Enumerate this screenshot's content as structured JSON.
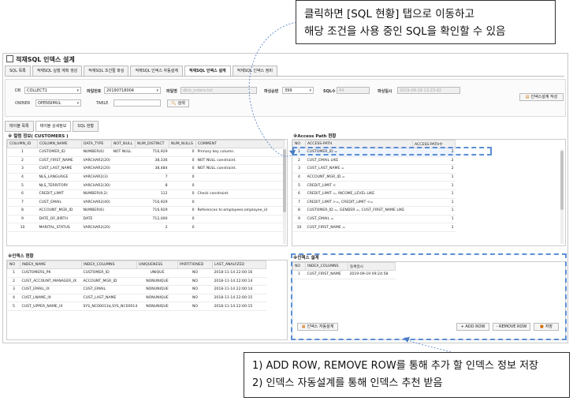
{
  "callouts": {
    "top": [
      "클릭하면 [SQL 현황] 탭으로 이동하고",
      "해당 조건을 사용 중인 SQL을 확인할 수 있음"
    ],
    "bottom": [
      "1) ADD ROW, REMOVE ROW를 통해  추가 할 인덱스 정보 저장",
      "2) 인덱스 자동설계를 통해 인덱스 추천 받음"
    ]
  },
  "window_title": "적재SQL 인덱스 설계",
  "tabs": [
    "SQL 목록",
    "적재SQL 실행 계획 생성",
    "적재SQL 조건절 파싱",
    "적재SQL 인덱스 자동설계",
    "적재SQL 인덱스 설계",
    "적재SQL 인덱스 정비"
  ],
  "active_tab_index": 4,
  "filter": {
    "db_label": "DB",
    "db_value": "COLLECT1",
    "file_no_label": "파일번호",
    "file_no_value": "20190718004",
    "file_name_label": "파일명",
    "file_name_value": "dbio_orders.txt",
    "parse_order_label": "파싱순번",
    "parse_order_value": "399",
    "sql_count_label": "SQL수",
    "sql_count_value": "84",
    "parse_date_label": "파싱일시",
    "parse_date_value": "2019-08-18 13:23:42",
    "owner_label": "OWNER",
    "owner_value": "OPENSIMUL",
    "table_label": "TABLE",
    "table_value": "",
    "search_button": "검색",
    "write_button": "인덱스설계 작성"
  },
  "subtabs": [
    "테이블 목록",
    "테이블 상세정보",
    "SQL 현황"
  ],
  "active_subtab_index": 1,
  "columns_panel": {
    "title": "※ 컬럼 정보( CUSTOMERS )",
    "headers": [
      "COLUMN_ID",
      "COLUMN_NAME",
      "DATA_TYPE",
      "NOT_NULL",
      "NUM_DISTINCT",
      "NUM_NULLS",
      "COMMENT"
    ],
    "rows": [
      [
        "1",
        "CUSTOMER_ID",
        "NUMBER(6)",
        "NOT NULL",
        "716,929",
        "0",
        "Primary key column."
      ],
      [
        "2",
        "CUST_FIRST_NAME",
        "VARCHAR2(20)",
        "",
        "38,336",
        "0",
        "NOT NULL constraint."
      ],
      [
        "3",
        "CUST_LAST_NAME",
        "VARCHAR2(20)",
        "",
        "38,484",
        "0",
        "NOT NULL constraint."
      ],
      [
        "4",
        "NLS_LANGUAGE",
        "VARCHAR2(3)",
        "",
        "7",
        "0",
        ""
      ],
      [
        "5",
        "NLS_TERRITORY",
        "VARCHAR2(30)",
        "",
        "8",
        "0",
        ""
      ],
      [
        "6",
        "CREDIT_LIMIT",
        "NUMBER(9,2)",
        "",
        "112",
        "0",
        "Check constraint."
      ],
      [
        "7",
        "CUST_EMAIL",
        "VARCHAR2(40)",
        "",
        "716,929",
        "0",
        ""
      ],
      [
        "8",
        "ACCOUNT_MGR_ID",
        "NUMBER(6)",
        "",
        "716,929",
        "0",
        "References hr.employees.employee_id"
      ],
      [
        "9",
        "DATE_OF_BIRTH",
        "DATE",
        "",
        "712,000",
        "0",
        ""
      ],
      [
        "10",
        "MARITAL_STATUS",
        "VARCHAR2(20)",
        "",
        "2",
        "0",
        ""
      ]
    ]
  },
  "access_panel": {
    "title": "※Access Path 현황",
    "headers": [
      "NO",
      "ACCESS-PATH",
      "ACCESS-PATH수"
    ],
    "rows": [
      [
        "1",
        "CUSTOMER_ID =",
        "2"
      ],
      [
        "2",
        "CUST_EMAIL LIKE",
        "2"
      ],
      [
        "3",
        "CUST_LAST_NAME =",
        "2"
      ],
      [
        "4",
        "ACCOUNT_MGR_ID =",
        "1"
      ],
      [
        "5",
        "CREDIT_LIMIT <",
        "1"
      ],
      [
        "6",
        "CREDIT_LIMIT =, INCOME_LEVEL LIKE",
        "1"
      ],
      [
        "7",
        "CREDIT_LIMIT >=, CREDIT_LIMIT <=",
        "1"
      ],
      [
        "8",
        "CUSTOMER_ID =, GENDER =, CUST_FIRST_NAME LIKE",
        "1"
      ],
      [
        "9",
        "CUST_EMAIL =",
        "1"
      ],
      [
        "10",
        "CUST_FIRST_NAME =",
        "1"
      ]
    ]
  },
  "index_panel": {
    "title": "※인덱스 현황",
    "headers": [
      "NO",
      "INDEX_NAME",
      "INDEX_COLUMNS",
      "UNIQUENESS",
      "PARTITIONED",
      "LAST_ANALYZED"
    ],
    "rows": [
      [
        "1",
        "CUSTOMERS_PK",
        "CUSTOMER_ID",
        "UNIQUE",
        "NO",
        "2018-11-14 22:00:16"
      ],
      [
        "2",
        "CUST_ACCOUNT_MANAGER_IX",
        "ACCOUNT_MGR_ID",
        "NONUNIQUE",
        "NO",
        "2018-11-14 22:00:14"
      ],
      [
        "3",
        "CUST_EMAIL_IX",
        "CUST_EMAIL",
        "NONUNIQUE",
        "NO",
        "2018-11-14 22:00:14"
      ],
      [
        "4",
        "CUST_LNAME_IX",
        "CUST_LAST_NAME",
        "NONUNIQUE",
        "NO",
        "2018-11-14 22:00:15"
      ],
      [
        "5",
        "CUST_UPPER_NAME_IX",
        "SYS_NC00013$,SYS_NC00014$",
        "NONUNIQUE",
        "NO",
        "2018-11-14 22:00:15"
      ]
    ]
  },
  "design_panel": {
    "title": "※인덱스 설계",
    "headers": [
      "NO",
      "INDEX_COLUMNS",
      "등록일시"
    ],
    "rows": [
      [
        "1",
        "CUST_FIRST_NAME",
        "2019-09-19 09:24:58"
      ]
    ],
    "auto_button": "인덱스 자동설계",
    "add_button": "+ ADD ROW",
    "remove_button": "- REMOVE ROW",
    "save_button": "저장"
  }
}
